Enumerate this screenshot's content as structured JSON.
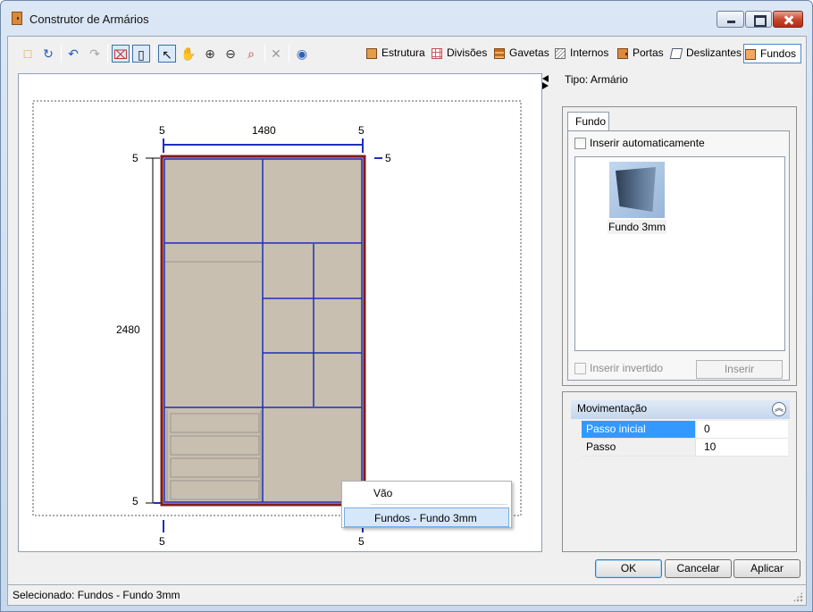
{
  "window": {
    "title": "Construtor de Armários"
  },
  "toolbar": {
    "icons": [
      "new-icon",
      "refresh-icon",
      "undo-icon",
      "redo-icon",
      "cabinet-view-icon",
      "door-view-icon",
      "pointer-icon",
      "pan-icon",
      "zoom-in-icon",
      "zoom-out-icon",
      "zoom-fit-icon",
      "delete-icon",
      "help-icon"
    ],
    "tabs": [
      {
        "label": "Estrutura",
        "icon": "structure-icon"
      },
      {
        "label": "Divisões",
        "icon": "grid-icon"
      },
      {
        "label": "Gavetas",
        "icon": "drawer-icon"
      },
      {
        "label": "Internos",
        "icon": "internal-icon"
      },
      {
        "label": "Portas",
        "icon": "door-icon"
      },
      {
        "label": "Deslizantes",
        "icon": "sliding-door-icon"
      },
      {
        "label": "Fundos",
        "icon": "back-panel-icon",
        "active": true
      }
    ]
  },
  "drawing": {
    "dimensions": {
      "top_left_margin": "5",
      "width": "1480",
      "top_right_margin": "5",
      "left_top_margin": "5",
      "right_top_margin": "5",
      "height": "2480",
      "left_bottom_margin": "5",
      "bottom_left_margin": "5",
      "bottom_right_margin": "5"
    },
    "colors": {
      "panel": "#c8bfb1",
      "frame": "#7f1d18",
      "division": "#1f2fba"
    }
  },
  "context_menu": {
    "items": [
      {
        "label": "Vão"
      },
      {
        "label": "Fundos - Fundo 3mm",
        "highlighted": true
      }
    ]
  },
  "properties": {
    "type_label": "Tipo: Armário",
    "tab": "Fundo",
    "auto_insert_label": "Inserir automaticamente",
    "auto_insert_checked": false,
    "items": [
      {
        "label": "Fundo 3mm",
        "icon": "back-panel-thumbnail"
      }
    ],
    "inverted_label": "Inserir invertido",
    "inverted_checked": false,
    "insert_button": "Inserir"
  },
  "movement": {
    "title": "Movimentação",
    "rows": [
      {
        "name": "Passo inicial",
        "value": "0",
        "selected": true
      },
      {
        "name": "Passo",
        "value": "10",
        "selected": false
      }
    ]
  },
  "buttons": {
    "ok": "OK",
    "cancel": "Cancelar",
    "apply": "Aplicar"
  },
  "status": {
    "text": "Selecionado: Fundos - Fundo 3mm"
  }
}
